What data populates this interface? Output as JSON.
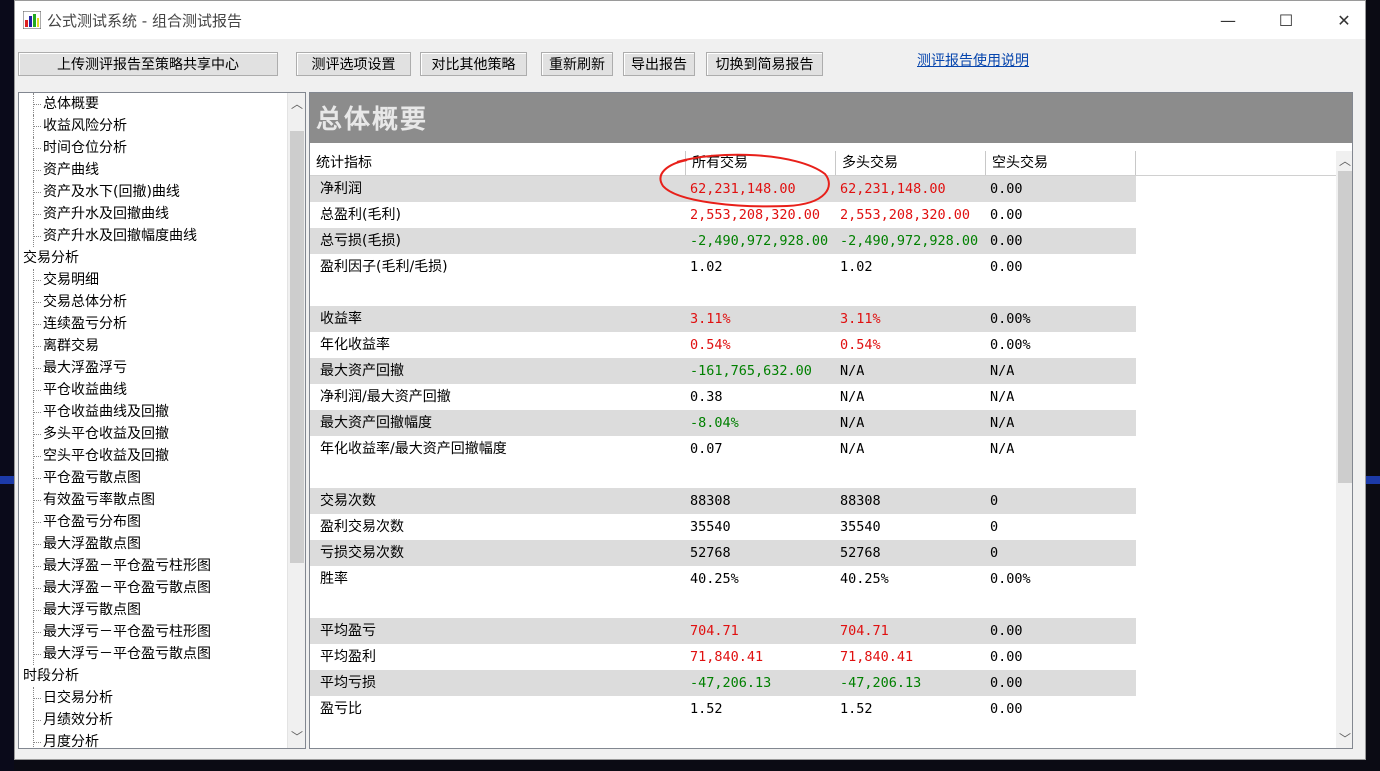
{
  "window": {
    "title": "公式测试系统 - 组合测试报告",
    "controls": {
      "minimize": "—",
      "maximize": "☐",
      "close": "✕"
    }
  },
  "toolbar": {
    "upload": "上传测评报告至策略共享中心",
    "options": "测评选项设置",
    "compare": "对比其他策略",
    "refresh": "重新刷新",
    "export": "导出报告",
    "switch": "切换到简易报告",
    "help_link": "测评报告使用说明"
  },
  "tree": {
    "items": [
      {
        "label": "总体概要",
        "level": 1
      },
      {
        "label": "收益风险分析",
        "level": 1
      },
      {
        "label": "时间仓位分析",
        "level": 1
      },
      {
        "label": "资产曲线",
        "level": 1
      },
      {
        "label": "资产及水下(回撤)曲线",
        "level": 1
      },
      {
        "label": "资产升水及回撤曲线",
        "level": 1
      },
      {
        "label": "资产升水及回撤幅度曲线",
        "level": 1
      },
      {
        "label": "交易分析",
        "level": 0
      },
      {
        "label": "交易明细",
        "level": 1
      },
      {
        "label": "交易总体分析",
        "level": 1
      },
      {
        "label": "连续盈亏分析",
        "level": 1
      },
      {
        "label": "离群交易",
        "level": 1
      },
      {
        "label": "最大浮盈浮亏",
        "level": 1
      },
      {
        "label": "平仓收益曲线",
        "level": 1
      },
      {
        "label": "平仓收益曲线及回撤",
        "level": 1
      },
      {
        "label": "多头平仓收益及回撤",
        "level": 1
      },
      {
        "label": "空头平仓收益及回撤",
        "level": 1
      },
      {
        "label": "平仓盈亏散点图",
        "level": 1
      },
      {
        "label": "有效盈亏率散点图",
        "level": 1
      },
      {
        "label": "平仓盈亏分布图",
        "level": 1
      },
      {
        "label": "最大浮盈散点图",
        "level": 1
      },
      {
        "label": "最大浮盈－平仓盈亏柱形图",
        "level": 1
      },
      {
        "label": "最大浮盈－平仓盈亏散点图",
        "level": 1
      },
      {
        "label": "最大浮亏散点图",
        "level": 1
      },
      {
        "label": "最大浮亏－平仓盈亏柱形图",
        "level": 1
      },
      {
        "label": "最大浮亏－平仓盈亏散点图",
        "level": 1
      },
      {
        "label": "时段分析",
        "level": 0
      },
      {
        "label": "日交易分析",
        "level": 1
      },
      {
        "label": "月绩效分析",
        "level": 1
      },
      {
        "label": "月度分析",
        "level": 1
      }
    ]
  },
  "report": {
    "banner": "总体概要",
    "headers": [
      "统计指标",
      "所有交易",
      "多头交易",
      "空头交易"
    ],
    "rows": [
      {
        "label": "净利润",
        "all": "62,231,148.00",
        "long": "62,231,148.00",
        "short": "0.00",
        "color": "red",
        "shade": true
      },
      {
        "label": "总盈利(毛利)",
        "all": "2,553,208,320.00",
        "long": "2,553,208,320.00",
        "short": "0.00",
        "color": "red",
        "shade": false
      },
      {
        "label": "总亏损(毛损)",
        "all": "-2,490,972,928.00",
        "long": "-2,490,972,928.00",
        "short": "0.00",
        "color": "green",
        "shade": true
      },
      {
        "label": "盈利因子(毛利/毛损)",
        "all": "1.02",
        "long": "1.02",
        "short": "0.00",
        "color": "black",
        "shade": false
      },
      {
        "label": "收益率",
        "all": "3.11%",
        "long": "3.11%",
        "short": "0.00%",
        "color": "red",
        "shade": true,
        "gap": true
      },
      {
        "label": "年化收益率",
        "all": "0.54%",
        "long": "0.54%",
        "short": "0.00%",
        "color": "red",
        "shade": false
      },
      {
        "label": "最大资产回撤",
        "all": "-161,765,632.00",
        "long": "N/A",
        "short": "N/A",
        "color": "green",
        "shade": true
      },
      {
        "label": "净利润/最大资产回撤",
        "all": "0.38",
        "long": "N/A",
        "short": "N/A",
        "color": "black",
        "shade": false
      },
      {
        "label": "最大资产回撤幅度",
        "all": "-8.04%",
        "long": "N/A",
        "short": "N/A",
        "color": "green",
        "shade": true
      },
      {
        "label": "年化收益率/最大资产回撤幅度",
        "all": "0.07",
        "long": "N/A",
        "short": "N/A",
        "color": "black",
        "shade": false
      },
      {
        "label": "交易次数",
        "all": "88308",
        "long": "88308",
        "short": "0",
        "color": "black",
        "shade": true,
        "gap": true
      },
      {
        "label": "盈利交易次数",
        "all": "35540",
        "long": "35540",
        "short": "0",
        "color": "black",
        "shade": false
      },
      {
        "label": "亏损交易次数",
        "all": "52768",
        "long": "52768",
        "short": "0",
        "color": "black",
        "shade": true
      },
      {
        "label": "胜率",
        "all": "40.25%",
        "long": "40.25%",
        "short": "0.00%",
        "color": "black",
        "shade": false
      },
      {
        "label": "平均盈亏",
        "all": "704.71",
        "long": "704.71",
        "short": "0.00",
        "color": "red",
        "shade": true,
        "gap": true
      },
      {
        "label": "平均盈利",
        "all": "71,840.41",
        "long": "71,840.41",
        "short": "0.00",
        "color": "red",
        "shade": false
      },
      {
        "label": "平均亏损",
        "all": "-47,206.13",
        "long": "-47,206.13",
        "short": "0.00",
        "color": "green",
        "shade": true
      },
      {
        "label": "盈亏比",
        "all": "1.52",
        "long": "1.52",
        "short": "0.00",
        "color": "black",
        "shade": false
      }
    ]
  },
  "colors": {
    "red": "#e01010",
    "green": "#008000",
    "black": "#000000",
    "annotation": "#e8201a"
  }
}
